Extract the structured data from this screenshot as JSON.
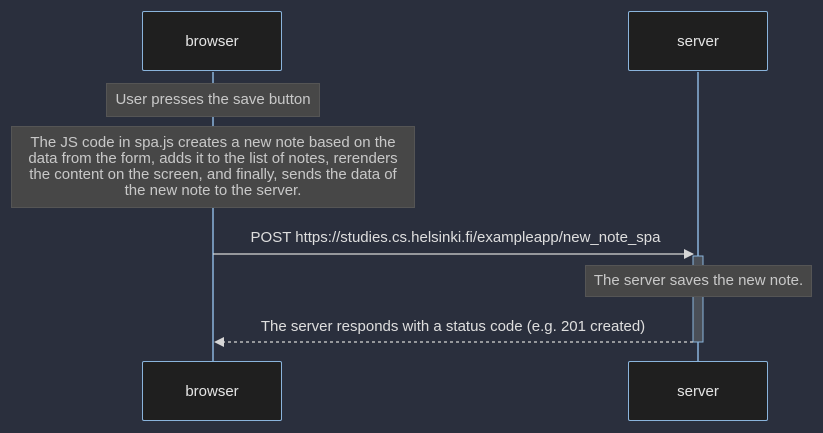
{
  "diagram": {
    "participants": [
      {
        "id": "browser",
        "label": "browser"
      },
      {
        "id": "server",
        "label": "server"
      }
    ],
    "notes": {
      "user_presses": "User presses the save button",
      "js_code": "The JS code in spa.js creates a new note based on the data from the form, adds it to the list of notes, rerenders the content on the screen, and finally, sends the data of the new note to the server.",
      "server_saves": "The server saves the new note."
    },
    "messages": [
      {
        "from": "browser",
        "to": "server",
        "label": "POST https://studies.cs.helsinki.fi/exampleapp/new_note_spa",
        "style": "solid"
      },
      {
        "from": "server",
        "to": "browser",
        "label": "The server responds with a status code (e.g. 201 created)",
        "style": "dashed"
      }
    ],
    "colors": {
      "background": "#2a2f3d",
      "lifeline": "#8ab4dc",
      "actor_fill": "#1f1f1f",
      "note_fill": "#474747",
      "arrow": "#d6d6d6"
    }
  }
}
